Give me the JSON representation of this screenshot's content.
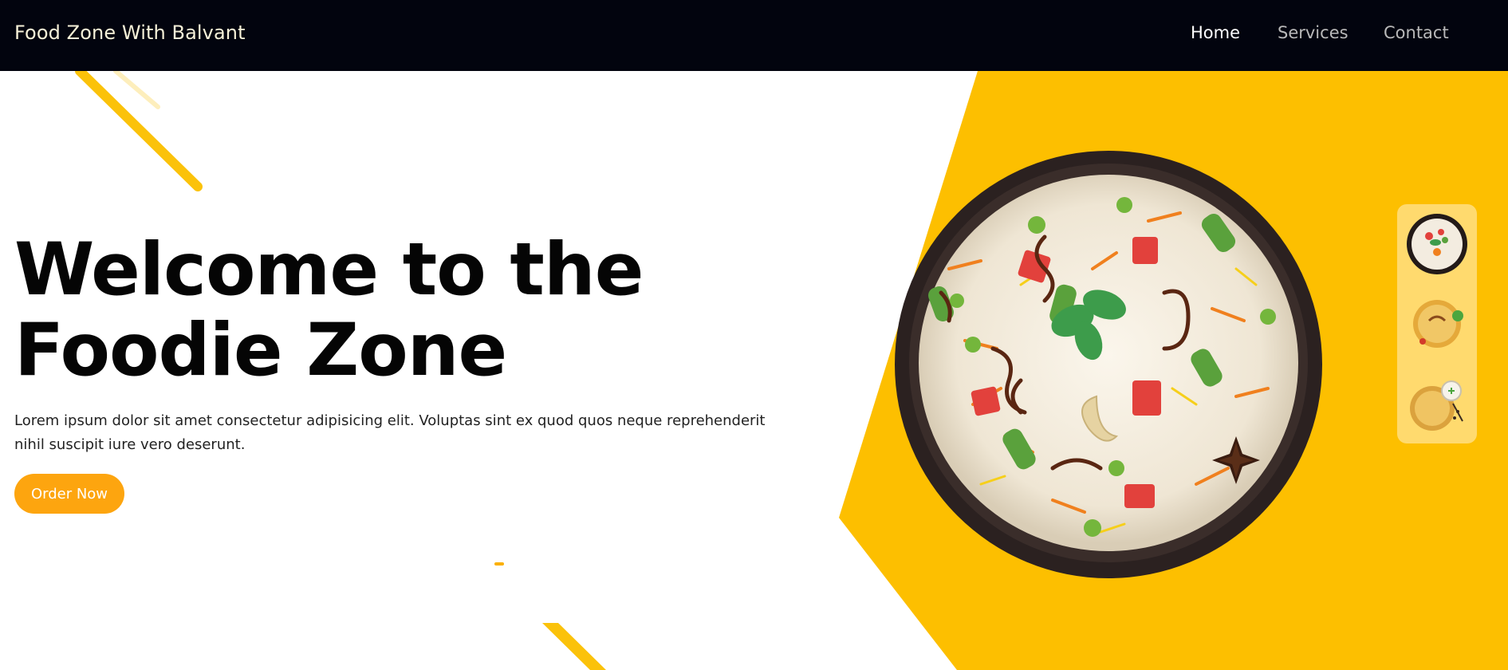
{
  "navbar": {
    "brand": "Food Zone With Balvant",
    "links": [
      {
        "label": "Home",
        "active": true
      },
      {
        "label": "Services",
        "active": false
      },
      {
        "label": "Contact",
        "active": false
      }
    ]
  },
  "hero": {
    "title_line1": "Welcome to the",
    "title_line2": "Foodie Zone",
    "description": "Lorem ipsum dolor sit amet consectetur adipisicing elit. Voluptas sint ex quod quos neque reprehenderit nihil suscipit iure vero deserunt.",
    "cta_label": "Order Now"
  },
  "thumbnails": [
    {
      "name": "biryani-bowl-top-view"
    },
    {
      "name": "biryani-platter-with-garnish"
    },
    {
      "name": "biryani-platter-with-raita"
    }
  ],
  "colors": {
    "navbar_bg": "#02040e",
    "accent_yellow": "#fdbf00",
    "button_orange": "#fda50f",
    "thumb_strip_bg": "#ffda6e",
    "heading_text": "#050505"
  }
}
